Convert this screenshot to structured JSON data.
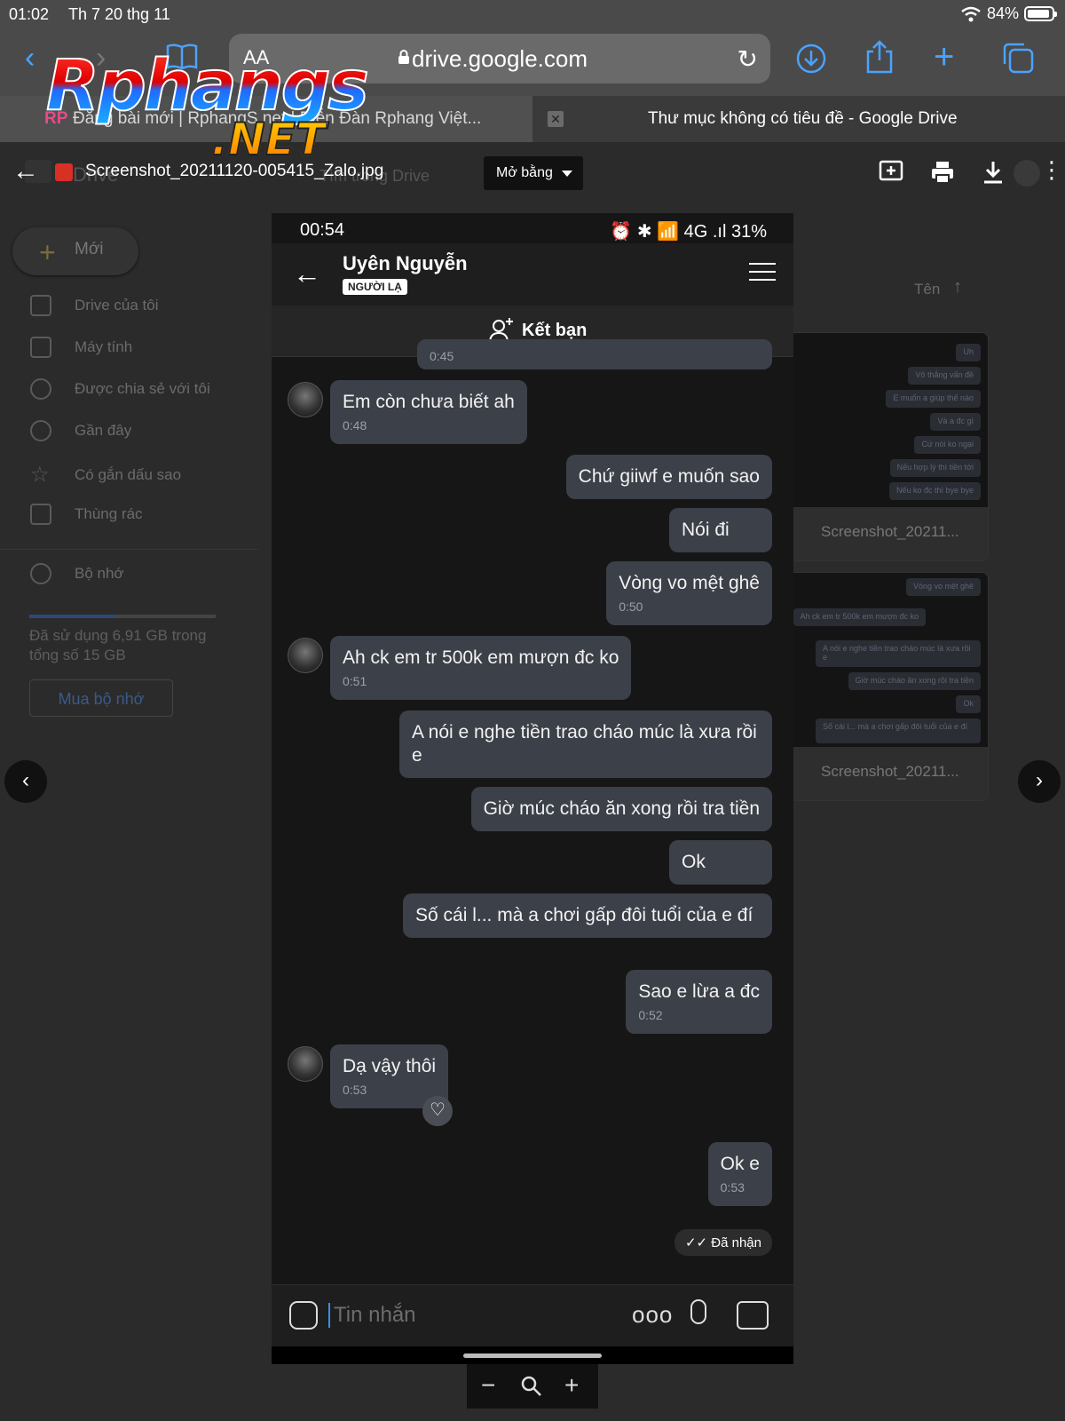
{
  "ipad_status": {
    "time": "01:02",
    "date": "Th 7 20 thg 11",
    "battery": "84%"
  },
  "safari": {
    "aa_label": "AA",
    "url": "drive.google.com",
    "tabs": [
      {
        "label": "Đăng bài mới | RphangS.net | Diễn Đàn Rphang Việt...",
        "favicon": "RP"
      },
      {
        "label": "Thư mục không có tiêu đề - Google Drive"
      }
    ]
  },
  "drive": {
    "logo_text": "Drive",
    "search_hint": "Tìm trong Drive",
    "new_label": "Mới",
    "sidebar": [
      {
        "label": "Drive của tôi",
        "icon": "drive-icon"
      },
      {
        "label": "Máy tính",
        "icon": "computer-icon"
      },
      {
        "label": "Được chia sẻ với tôi",
        "icon": "shared-icon"
      },
      {
        "label": "Gần đây",
        "icon": "clock-icon"
      },
      {
        "label": "Có gắn dấu sao",
        "icon": "star-icon"
      },
      {
        "label": "Thùng rác",
        "icon": "trash-icon"
      }
    ],
    "storage_label": "Bộ nhớ",
    "storage_used_fraction": 0.46,
    "storage_text": "Đã sử dụng 6,91 GB trong tổng số 15 GB",
    "buy_label": "Mua bộ nhớ",
    "sort_label": "Tên",
    "files": [
      {
        "name": "Screenshot_20211...",
        "preview": [
          "Uh",
          "Vô thắng vấn đề",
          "E muốn a giúp thế nào",
          "Và a đc gì",
          "Cứ nói ko ngại",
          "Nếu hợp lý thì tiền tới",
          "Nếu ko đc thì bye bye"
        ]
      },
      {
        "name": "Screenshot_20211...",
        "preview": [
          "Vòng vo mệt ghê",
          "Ah ck em tr 500k em mượn đc ko",
          "A nói e nghe tiền trao cháo múc là xưa rồi e",
          "Giờ múc cháo ăn xong rồi tra tiền",
          "Ok",
          "Số cái l... mà a chơi gấp đôi tuổi của e đí"
        ]
      }
    ]
  },
  "viewer": {
    "filename": "Screenshot_20211120-005415_Zalo.jpg",
    "open_with": "Mở bằng"
  },
  "phone": {
    "time": "00:54",
    "status_right": "⏰ ✱ 📶 4G .ıl 31%",
    "contact_name": "Uyên Nguyễn",
    "stranger_badge": "NGƯỜI LẠ",
    "add_friend": "Kết bạn",
    "messages": [
      {
        "side": "out",
        "text": "",
        "time": "0:45"
      },
      {
        "side": "in",
        "text": "Em còn chưa biết ah",
        "time": "0:48"
      },
      {
        "side": "out",
        "text": "Chứ giiwf e muốn sao",
        "time": ""
      },
      {
        "side": "out",
        "text": "Nói đi",
        "time": ""
      },
      {
        "side": "out",
        "text": "Vòng vo mệt ghê",
        "time": "0:50"
      },
      {
        "side": "in",
        "text": "Ah ck em tr 500k em mượn đc ko",
        "time": "0:51"
      },
      {
        "side": "out",
        "text": "A nói e nghe tiền trao cháo múc là xưa rồi e",
        "time": ""
      },
      {
        "side": "out",
        "text": "Giờ múc cháo ăn xong rồi tra tiền",
        "time": ""
      },
      {
        "side": "out",
        "text": "Ok",
        "time": ""
      },
      {
        "side": "out",
        "text": "Số cái l... mà a chơi gấp đôi tuổi của e đí",
        "time": ""
      },
      {
        "side": "out",
        "text": "Sao e lừa a đc",
        "time": "0:52"
      },
      {
        "side": "in",
        "text": "Dạ vậy thôi",
        "time": "0:53"
      },
      {
        "side": "out",
        "text": "Ok e",
        "time": "0:53"
      }
    ],
    "received_label": "Đã nhận",
    "input_placeholder": "Tin nhắn",
    "more_label": "ooo"
  },
  "zoom": {
    "minus": "−",
    "plus": "+"
  },
  "watermark": {
    "line1": "Rphangs",
    "line2": ".NET"
  },
  "colors": {
    "accent_blue": "#4aa3ff",
    "bubble": "#3c4048",
    "background": "#161616"
  }
}
